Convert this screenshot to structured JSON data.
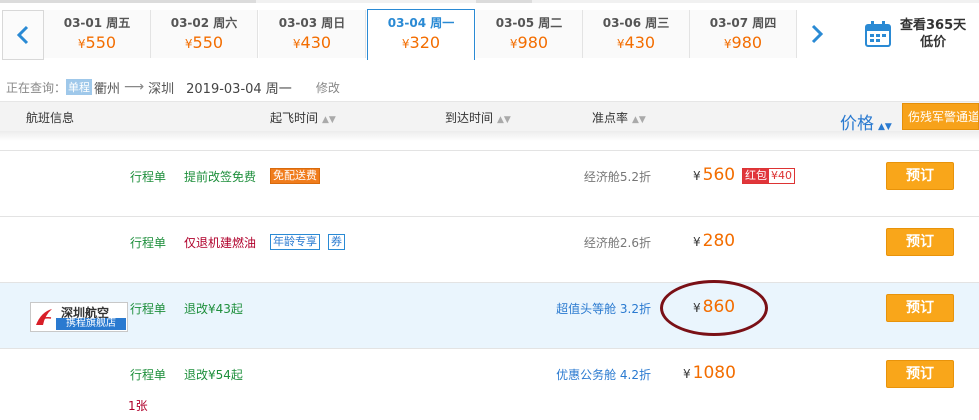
{
  "dates": [
    {
      "date": "03-01 周五",
      "price": "550",
      "selected": false
    },
    {
      "date": "03-02 周六",
      "price": "550",
      "selected": false
    },
    {
      "date": "03-03 周日",
      "price": "430",
      "selected": false
    },
    {
      "date": "03-04 周一",
      "price": "320",
      "selected": true
    },
    {
      "date": "03-05 周二",
      "price": "980",
      "selected": false
    },
    {
      "date": "03-06 周三",
      "price": "430",
      "selected": false
    },
    {
      "date": "03-07 周四",
      "price": "980",
      "selected": false
    }
  ],
  "currency": "¥",
  "calendar": {
    "line1": "查看365天",
    "line2": "低价"
  },
  "query": {
    "label": "正在查询：",
    "trip_type": "单程",
    "from": "衢州",
    "to": "深圳",
    "date": "2019-03-04 周一",
    "modify": "修改"
  },
  "header": {
    "flight": "航班信息",
    "depart": "起飞时间",
    "arrive": "到达时间",
    "ontime": "准点率",
    "price": "价格",
    "promo": "伤残军警通道"
  },
  "rows": [
    {
      "itinerary": "行程单",
      "policy": "提前改签免费",
      "tag": "免配送费",
      "cabin": "经济舱5.2折",
      "price": "560",
      "hongbao_label": "红包",
      "hongbao_value": "¥40",
      "book": "预订"
    },
    {
      "itinerary": "行程单",
      "policy": "仅退机建燃油",
      "tags": [
        "年龄专享",
        "券"
      ],
      "cabin": "经济舱2.6折",
      "price": "280",
      "book": "预订"
    },
    {
      "itinerary": "行程单",
      "policy": "退改¥43起",
      "cabin": "超值头等舱 3.2折",
      "price": "860",
      "book": "预订",
      "airline": "深圳航空",
      "store": "携程旗舰店"
    },
    {
      "itinerary": "行程单",
      "policy": "退改¥54起",
      "cabin": "优惠公务舱 4.2折",
      "price": "1080",
      "book": "预订",
      "seats_left": "1张"
    }
  ],
  "colors": {
    "accent": "#2a8ad4",
    "price": "#f36d00",
    "button": "#f9a61a",
    "highlight_row": "#eaf5fd",
    "annotation": "#7a1016"
  }
}
